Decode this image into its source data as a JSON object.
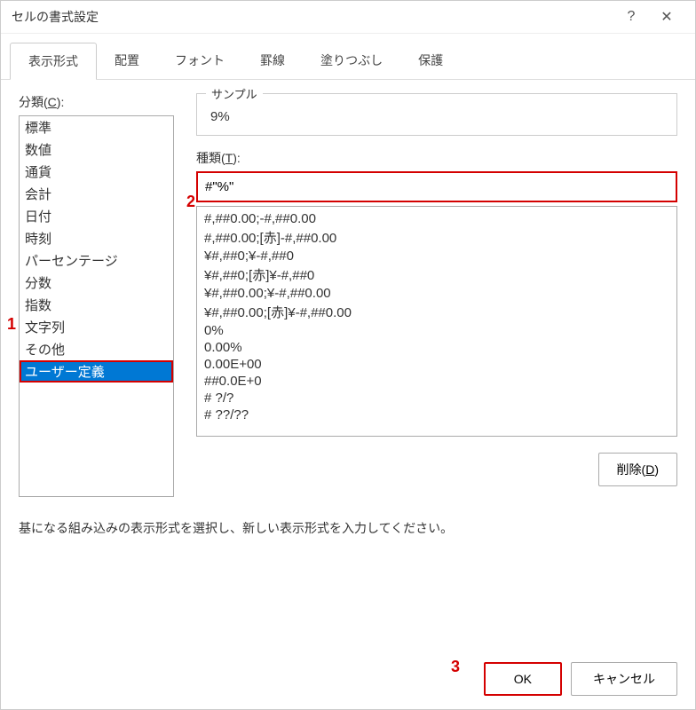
{
  "title": "セルの書式設定",
  "tabs": {
    "number": "表示形式",
    "alignment": "配置",
    "font": "フォント",
    "border": "罫線",
    "fill": "塗りつぶし",
    "protection": "保護"
  },
  "categoryLabelPrefix": "分類(",
  "categoryLabelKey": "C",
  "categoryLabelSuffix": "):",
  "categories": {
    "0": "標準",
    "1": "数値",
    "2": "通貨",
    "3": "会計",
    "4": "日付",
    "5": "時刻",
    "6": "パーセンテージ",
    "7": "分数",
    "8": "指数",
    "9": "文字列",
    "10": "その他",
    "11": "ユーザー定義"
  },
  "sampleLabel": "サンプル",
  "sampleValue": "9%",
  "typeLabelPrefix": "種類(",
  "typeLabelKey": "T",
  "typeLabelSuffix": "):",
  "typeInputValue": "#\"%\"",
  "typeList": {
    "0": "#,##0.00;-#,##0.00",
    "1": "#,##0.00;[赤]-#,##0.00",
    "2": "¥#,##0;¥-#,##0",
    "3": "¥#,##0;[赤]¥-#,##0",
    "4": "¥#,##0.00;¥-#,##0.00",
    "5": "¥#,##0.00;[赤]¥-#,##0.00",
    "6": "0%",
    "7": "0.00%",
    "8": "0.00E+00",
    "9": "##0.0E+0",
    "10": "# ?/?",
    "11": "# ??/??"
  },
  "deleteLabelPrefix": "削除(",
  "deleteLabelKey": "D",
  "deleteLabelSuffix": ")",
  "hintText": "基になる組み込みの表示形式を選択し、新しい表示形式を入力してください。",
  "okLabel": "OK",
  "cancelLabel": "キャンセル",
  "annotations": {
    "a1": "1",
    "a2": "2",
    "a3": "3"
  }
}
